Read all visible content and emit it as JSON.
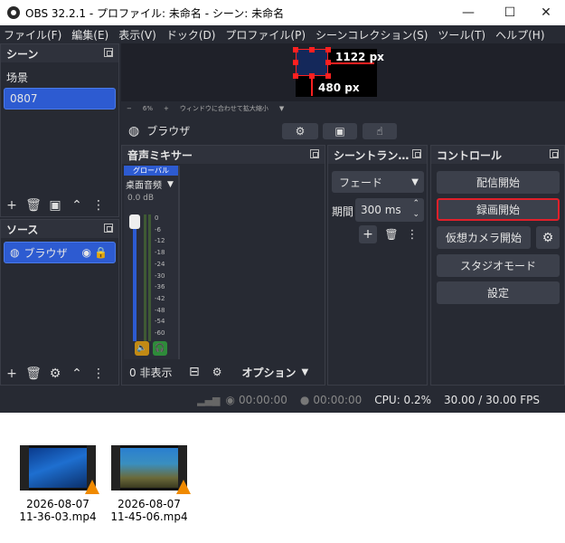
{
  "window": {
    "title": "OBS 32.2.1 - プロファイル: 未命名 - シーン: 未命名",
    "minimize": "—",
    "maximize": "☐",
    "close": "✕"
  },
  "menu": [
    "ファイル(F)",
    "編集(E)",
    "表示(V)",
    "ドック(D)",
    "プロファイル(P)",
    "シーンコレクション(S)",
    "ツール(T)",
    "ヘルプ(H)"
  ],
  "preview": {
    "width_label": "1122 px",
    "height_label": "480 px"
  },
  "zoom": {
    "minus": "−",
    "value": "6%",
    "plus": "+",
    "fit": "ウィンドウに合わせて拡大縮小"
  },
  "source_toolbar": {
    "source_name": "ブラウザ"
  },
  "scenes": {
    "title": "シーン",
    "items": [
      "场景",
      "0807"
    ],
    "selected": 1
  },
  "sources": {
    "title": "ソース",
    "items": [
      {
        "name": "ブラウザ"
      }
    ]
  },
  "mixer": {
    "title": "音声ミキサー",
    "global_label": "グローバル",
    "channel": "桌面音频",
    "volume": "0.0 dB",
    "scale": [
      "0",
      "-6",
      "-12",
      "-18",
      "-24",
      "-30",
      "-36",
      "-42",
      "-48",
      "-54",
      "-60"
    ],
    "hidden_label": "0 非表示",
    "options_label": "オプション"
  },
  "transitions": {
    "title": "シーントラン…",
    "type": "フェード",
    "duration_label": "期間",
    "duration": "300 ms"
  },
  "controls": {
    "title": "コントロール",
    "stream": "配信開始",
    "record": "録画開始",
    "virtualcam": "仮想カメラ開始",
    "studio": "スタジオモード",
    "settings": "設定"
  },
  "status": {
    "stream_time": "00:00:00",
    "rec_time": "00:00:00",
    "cpu": "CPU: 0.2%",
    "fps": "30.00 / 30.00 FPS"
  },
  "files": [
    {
      "date": "2026-08-07",
      "name": "11-36-03.mp4"
    },
    {
      "date": "2026-08-07",
      "name": "11-45-06.mp4"
    }
  ],
  "colors": {
    "accent": "#2d5bd1",
    "record_highlight": "#e0202a",
    "bg": "#272a33"
  }
}
